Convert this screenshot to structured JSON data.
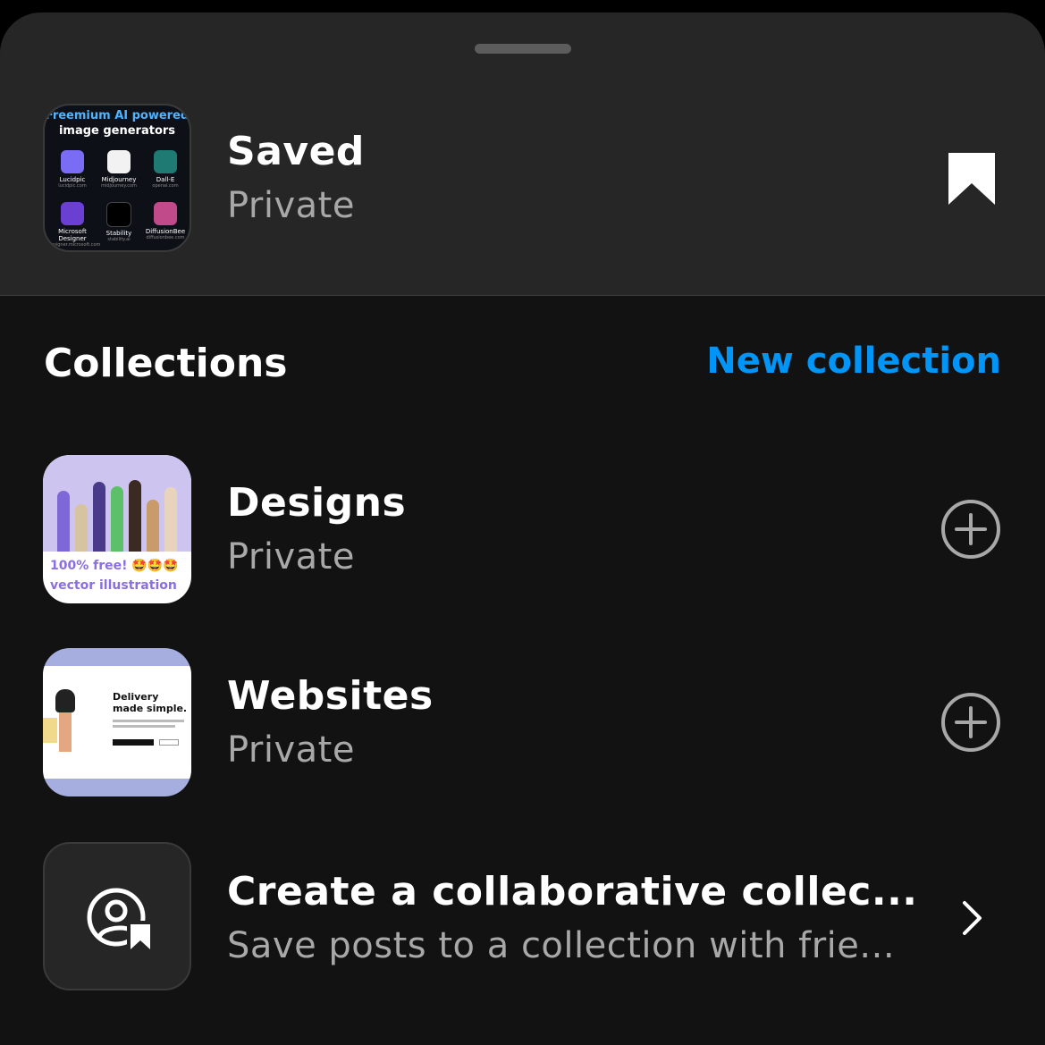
{
  "saved": {
    "title": "Saved",
    "subtitle": "Private",
    "thumbnail": {
      "heading_line1": "Freemium AI powered",
      "heading_line2": "image generators",
      "apps": [
        {
          "name": "Lucidpic",
          "url": "lucidpic.com",
          "color": "#7b6cf6"
        },
        {
          "name": "Midjourney",
          "url": "midjourney.com",
          "color": "#f2f2f2"
        },
        {
          "name": "Dall-E",
          "url": "openai.com",
          "color": "#1f7a74"
        },
        {
          "name": "Microsoft Designer",
          "url": "designer.microsoft.com",
          "color": "#6b3fd1"
        },
        {
          "name": "Stability",
          "url": "stability.ai",
          "color": "#000000"
        },
        {
          "name": "DiffusionBee",
          "url": "diffusionbee.com",
          "color": "#c04a8a"
        }
      ]
    },
    "bookmark_icon": "bookmark-filled-icon"
  },
  "collections_section": {
    "heading": "Collections",
    "new_collection_label": "New collection"
  },
  "collections": [
    {
      "title": "Designs",
      "subtitle": "Private",
      "thumbnail": {
        "line1": "100% free! 🤩🤩🤩",
        "line2": "vector illustration"
      },
      "action_icon": "plus-circle-icon"
    },
    {
      "title": "Websites",
      "subtitle": "Private",
      "thumbnail": {
        "headline1": "Delivery",
        "headline2": "made simple."
      },
      "action_icon": "plus-circle-icon"
    }
  ],
  "collaborative": {
    "title": "Create a collaborative collec...",
    "subtitle": "Save posts to a collection with frie...",
    "icon": "user-bookmark-icon",
    "chevron_icon": "chevron-right-icon"
  },
  "colors": {
    "background": "#121212",
    "top_panel": "#262626",
    "accent_blue": "#0095f6",
    "secondary_text": "#a8a8a8"
  }
}
